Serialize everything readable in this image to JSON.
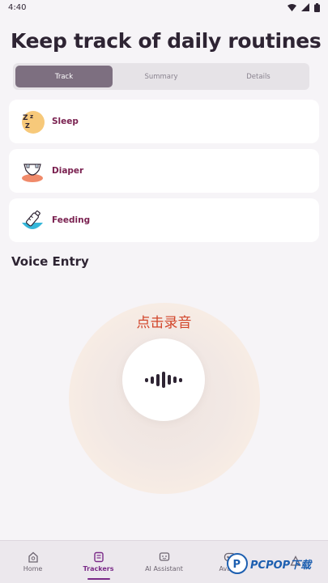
{
  "status": {
    "time": "4:40"
  },
  "header": {
    "title": "Keep track of daily routines"
  },
  "tabs": [
    {
      "label": "Track",
      "active": true
    },
    {
      "label": "Summary",
      "active": false
    },
    {
      "label": "Details",
      "active": false
    }
  ],
  "trackers": [
    {
      "label": "Sleep",
      "icon": "sleep-icon"
    },
    {
      "label": "Diaper",
      "icon": "diaper-icon"
    },
    {
      "label": "Feeding",
      "icon": "feeding-bottle-icon"
    }
  ],
  "voice": {
    "title": "Voice Entry",
    "record_prompt": "点击录音",
    "button_icon": "sound-wave-icon"
  },
  "nav": [
    {
      "label": "Home",
      "icon": "home-icon",
      "active": false
    },
    {
      "label": "Trackers",
      "icon": "trackers-icon",
      "active": true
    },
    {
      "label": "AI Assistant",
      "icon": "ai-assistant-icon",
      "active": false
    },
    {
      "label": "Avatar",
      "icon": "avatar-icon",
      "active": false
    },
    {
      "label": "",
      "icon": "more-icon",
      "active": false
    }
  ],
  "watermark": {
    "text": "PCPOP下载"
  },
  "colors": {
    "accent": "#7a2a88",
    "tab_active": "#7d6f80",
    "card_label": "#7a2150",
    "record_prompt": "#d2452a"
  }
}
